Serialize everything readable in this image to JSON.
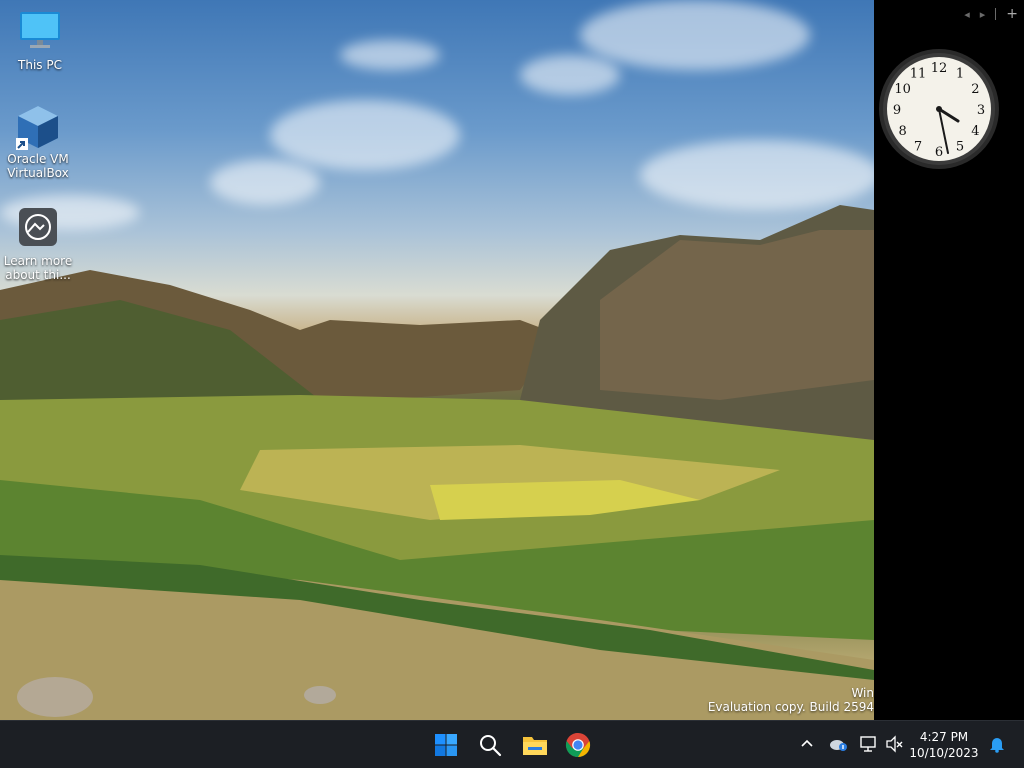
{
  "desktop": {
    "icons": [
      {
        "label": "This PC",
        "icon": "monitor-icon"
      },
      {
        "label": "Oracle VM VirtualBox",
        "icon": "virtualbox-icon"
      },
      {
        "label": "Learn more about thi...",
        "icon": "learn-more-icon"
      }
    ],
    "watermark": {
      "line1": "Win",
      "line2": "Evaluation copy. Build 2594"
    }
  },
  "sidebar": {
    "controls": {
      "prev": "◂",
      "next": "▸",
      "add": "+"
    },
    "clock": {
      "numerals": [
        "12",
        "1",
        "2",
        "3",
        "4",
        "5",
        "6",
        "7",
        "8",
        "9",
        "10",
        "11"
      ],
      "time": "4:27"
    }
  },
  "taskbar": {
    "apps": [
      {
        "name": "start",
        "icon": "windows-start-icon"
      },
      {
        "name": "search",
        "icon": "search-icon"
      },
      {
        "name": "file-explorer",
        "icon": "folder-icon"
      },
      {
        "name": "chrome",
        "icon": "chrome-icon"
      }
    ],
    "tray": {
      "time": "4:27 PM",
      "date": "10/10/2023"
    }
  },
  "colors": {
    "taskbar_bg": "#1c1f24",
    "sidebar_bg": "#000000",
    "start_blue": "#1e90ff",
    "folder_yellow": "#f6c33b"
  }
}
